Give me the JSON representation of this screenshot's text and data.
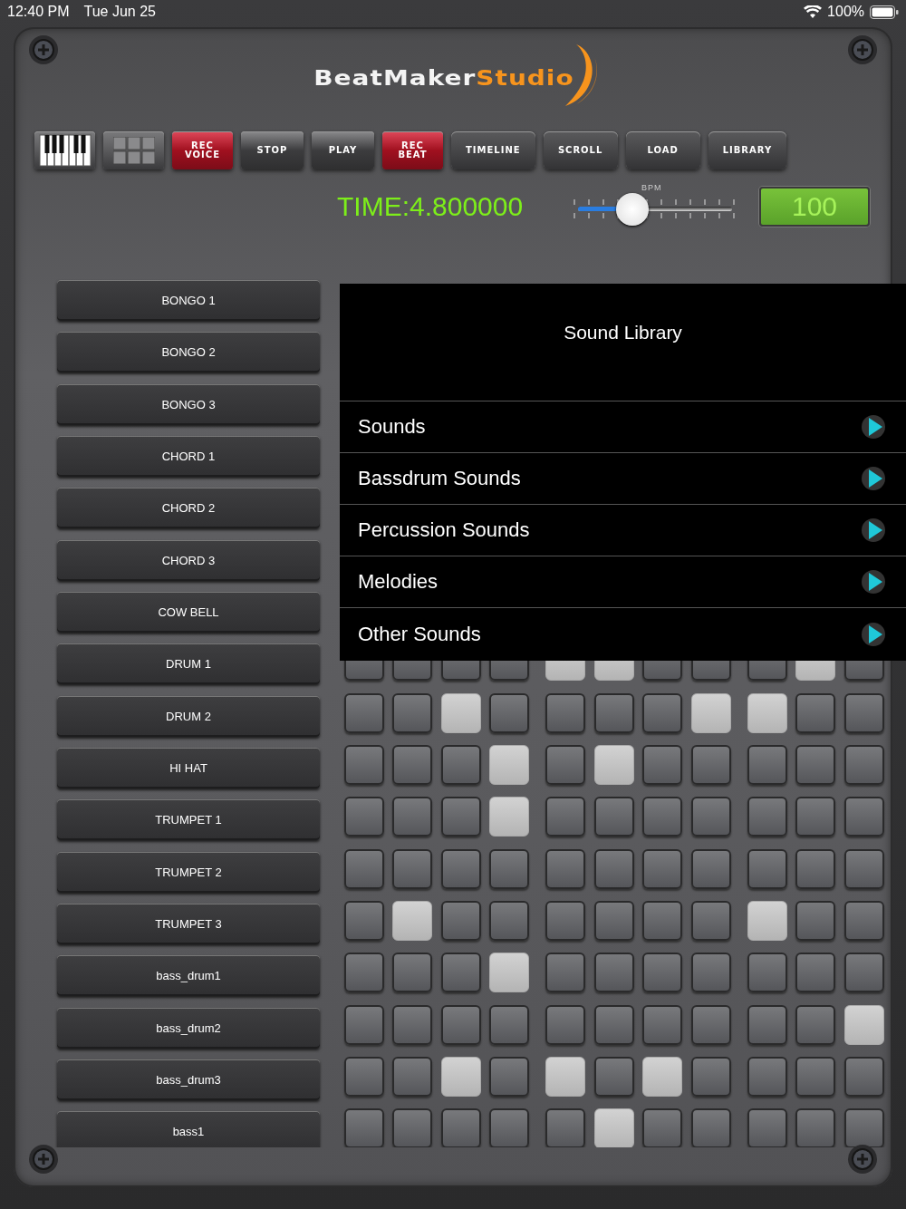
{
  "status_bar": {
    "time": "12:40 PM",
    "date": "Tue Jun 25",
    "battery": "100%"
  },
  "logo": {
    "part_1": "BeatMaker",
    "part_2": "Studio"
  },
  "toolbar": [
    {
      "kind": "piano"
    },
    {
      "kind": "grid"
    },
    {
      "kind": "record",
      "label": "REC VOICE"
    },
    {
      "kind": "plain",
      "label": "STOP"
    },
    {
      "kind": "plain",
      "label": "PLAY"
    },
    {
      "kind": "record",
      "label": "REC BEAT"
    },
    {
      "kind": "wide",
      "label": "TIMELINE"
    },
    {
      "kind": "wide",
      "label": "SCROLL"
    },
    {
      "kind": "wide",
      "label": "LOAD"
    },
    {
      "kind": "wide",
      "label": "LIBRARY"
    }
  ],
  "transport": {
    "time": "TIME:4.800000",
    "bpm_label": "BPM",
    "level": 0.35,
    "bpm": "100"
  },
  "tracks": [
    "BONGO 1",
    "BONGO 2",
    "BONGO 3",
    "CHORD 1",
    "CHORD 2",
    "CHORD 3",
    "COW BELL",
    "DRUM 1",
    "DRUM 2",
    "HI HAT",
    "TRUMPET 1",
    "TRUMPET 2",
    "TRUMPET 3",
    "bass_drum1",
    "bass_drum2",
    "bass_drum3",
    "bass1"
  ],
  "grid": {
    "rows": [
      {
        "pads": [
          false,
          false,
          false,
          false,
          true,
          true,
          false,
          false,
          false,
          true,
          false
        ]
      },
      {
        "pads": [
          false,
          false,
          true,
          false,
          false,
          false,
          false,
          true,
          true,
          false,
          false
        ]
      },
      {
        "pads": [
          false,
          false,
          false,
          true,
          false,
          true,
          false,
          false,
          false,
          false,
          false
        ]
      },
      {
        "pads": [
          false,
          false,
          false,
          true,
          false,
          false,
          false,
          false,
          false,
          false,
          false
        ]
      },
      {
        "pads": [
          false,
          false,
          false,
          false,
          false,
          false,
          false,
          false,
          false,
          false,
          false
        ]
      },
      {
        "pads": [
          false,
          true,
          false,
          false,
          false,
          false,
          false,
          false,
          true,
          false,
          false
        ]
      },
      {
        "pads": [
          false,
          false,
          false,
          true,
          false,
          false,
          false,
          false,
          false,
          false,
          false
        ]
      },
      {
        "pads": [
          false,
          false,
          false,
          false,
          false,
          false,
          false,
          false,
          false,
          false,
          true
        ]
      },
      {
        "pads": [
          false,
          false,
          true,
          false,
          true,
          false,
          true,
          false,
          false,
          false,
          false
        ]
      },
      {
        "pads": [
          false,
          false,
          false,
          false,
          false,
          true,
          false,
          false,
          false,
          false,
          false
        ]
      }
    ]
  },
  "sound_library": {
    "title": "Sound Library",
    "items": [
      "Sounds",
      "Bassdrum Sounds",
      "Percussion Sounds",
      "Melodies",
      "Other Sounds"
    ]
  }
}
